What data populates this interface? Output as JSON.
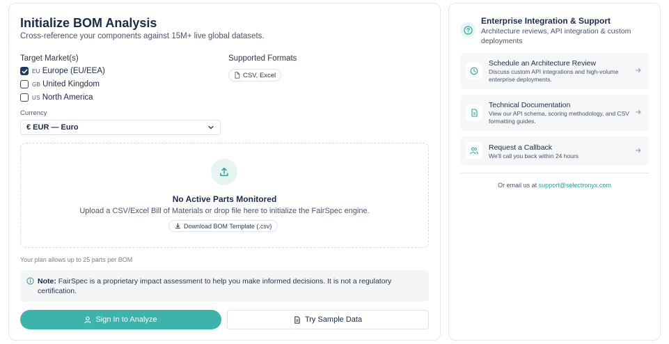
{
  "analysis": {
    "title": "Initialize BOM Analysis",
    "subtitle": "Cross-reference your components against 15M+ live global datasets.",
    "target_market_label": "Target Market(s)",
    "markets": [
      {
        "code": "EU",
        "label": "Europe (EU/EEA)",
        "checked": true
      },
      {
        "code": "GB",
        "label": "United Kingdom",
        "checked": false
      },
      {
        "code": "US",
        "label": "North America",
        "checked": false
      }
    ],
    "formats_label": "Supported Formats",
    "formats_chip": "CSV, Excel",
    "currency_label": "Currency",
    "currency_value": "€ EUR — Euro",
    "dropzone": {
      "title": "No Active Parts Monitored",
      "subtitle": "Upload a CSV/Excel Bill of Materials or drop file here to initialize the FairSpec engine.",
      "template_button": "Download BOM Template (.csv)"
    },
    "plan_note": "Your plan allows up to 25 parts per BOM",
    "note_label": "Note:",
    "note_text": " FairSpec is a proprietary impact assessment to help you make informed decisions. It is not a regulatory certification.",
    "sign_in_button": "Sign In to Analyze",
    "sample_button": "Try Sample Data"
  },
  "support": {
    "title": "Enterprise Integration & Support",
    "subtitle": "Architecture reviews, API integration & custom deployments",
    "items": [
      {
        "title": "Schedule an Architecture Review",
        "desc": "Discuss custom API integrations and high-volume enterprise deployments.",
        "icon": "clock-icon"
      },
      {
        "title": "Technical Documentation",
        "desc": "View our API schema, scoring methodology, and CSV formatting guides.",
        "icon": "document-icon"
      },
      {
        "title": "Request a Callback",
        "desc": "We'll call you back within 24 hours",
        "icon": "users-icon"
      }
    ],
    "email_prefix": "Or email us at ",
    "email": "support@selectronyx.com"
  },
  "colors": {
    "accent": "#3cb3ac",
    "navy": "#1b2b4b",
    "link": "#2aa198"
  }
}
